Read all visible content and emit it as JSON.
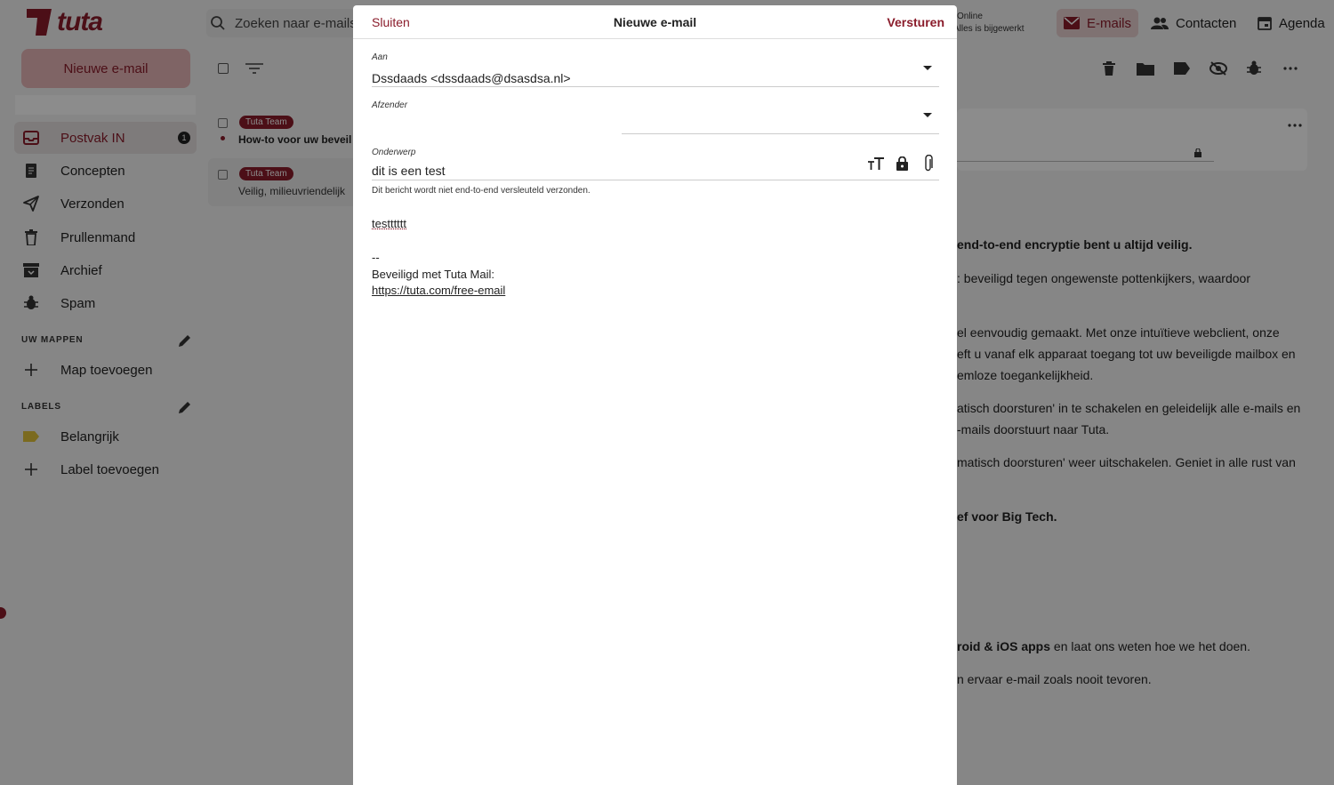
{
  "app": {
    "logo_text": "tuta",
    "search_placeholder": "Zoeken naar e-mails",
    "new_mail_button": "Nieuwe e-mail",
    "status_line1": "Online",
    "status_line2": "Alles is bijgewerkt",
    "top_nav": [
      "E-mails",
      "Contacten",
      "Agenda"
    ]
  },
  "sidebar": {
    "folders": [
      {
        "label": "Postvak IN",
        "badge": "1"
      },
      {
        "label": "Concepten"
      },
      {
        "label": "Verzonden"
      },
      {
        "label": "Prullenmand"
      },
      {
        "label": "Archief"
      },
      {
        "label": "Spam"
      }
    ],
    "my_folders_heading": "UW MAPPEN",
    "add_folder": "Map toevoegen",
    "labels_heading": "LABELS",
    "labels": [
      "Belangrijk"
    ],
    "add_label": "Label toevoegen"
  },
  "mail_list": [
    {
      "sender_tag": "Tuta Team",
      "subject": "How-to voor uw beveil",
      "unread": true
    },
    {
      "sender_tag": "Tuta Team",
      "subject": "Veilig, milieuvriendelijk",
      "unread": false
    }
  ],
  "reader": {
    "lines": [
      "end-to-end encryptie bent u altijd veilig.",
      ": beveiligd tegen ongewenste pottenkijkers, waardoor",
      "el eenvoudig gemaakt. Met onze intuïtieve webclient, onze",
      "eft u vanaf elk apparaat toegang tot uw beveiligde mailbox en",
      "emloze toegankelijkheid.",
      "atisch doorsturen' in te schakelen en geleidelijk alle e-mails en",
      "-mails doorstuurt naar Tuta.",
      "matisch doorsturen' weer uitschakelen. Geniet in alle rust van",
      "ef voor Big Tech.",
      "roid & iOS apps",
      " en laat ons weten hoe we het doen.",
      "n ervaar e-mail zoals nooit tevoren."
    ]
  },
  "compose": {
    "close": "Sluiten",
    "title": "Nieuwe e-mail",
    "send": "Versturen",
    "to_label": "Aan",
    "to_value": "Dssdaads <dssdaads@dsasdsa.nl>",
    "from_label": "Afzender",
    "subject_label": "Onderwerp",
    "subject_value": "dit is een test",
    "encryption_note": "Dit bericht wordt niet end-to-end versleuteld verzonden.",
    "body_line": "testttttt",
    "signature_sep": "--",
    "signature_text": "Beveiligd met Tuta Mail:",
    "signature_link": "https://tuta.com/free-email"
  },
  "colors": {
    "accent": "#8a1c2b",
    "label_yellow": "#e0c13a"
  }
}
